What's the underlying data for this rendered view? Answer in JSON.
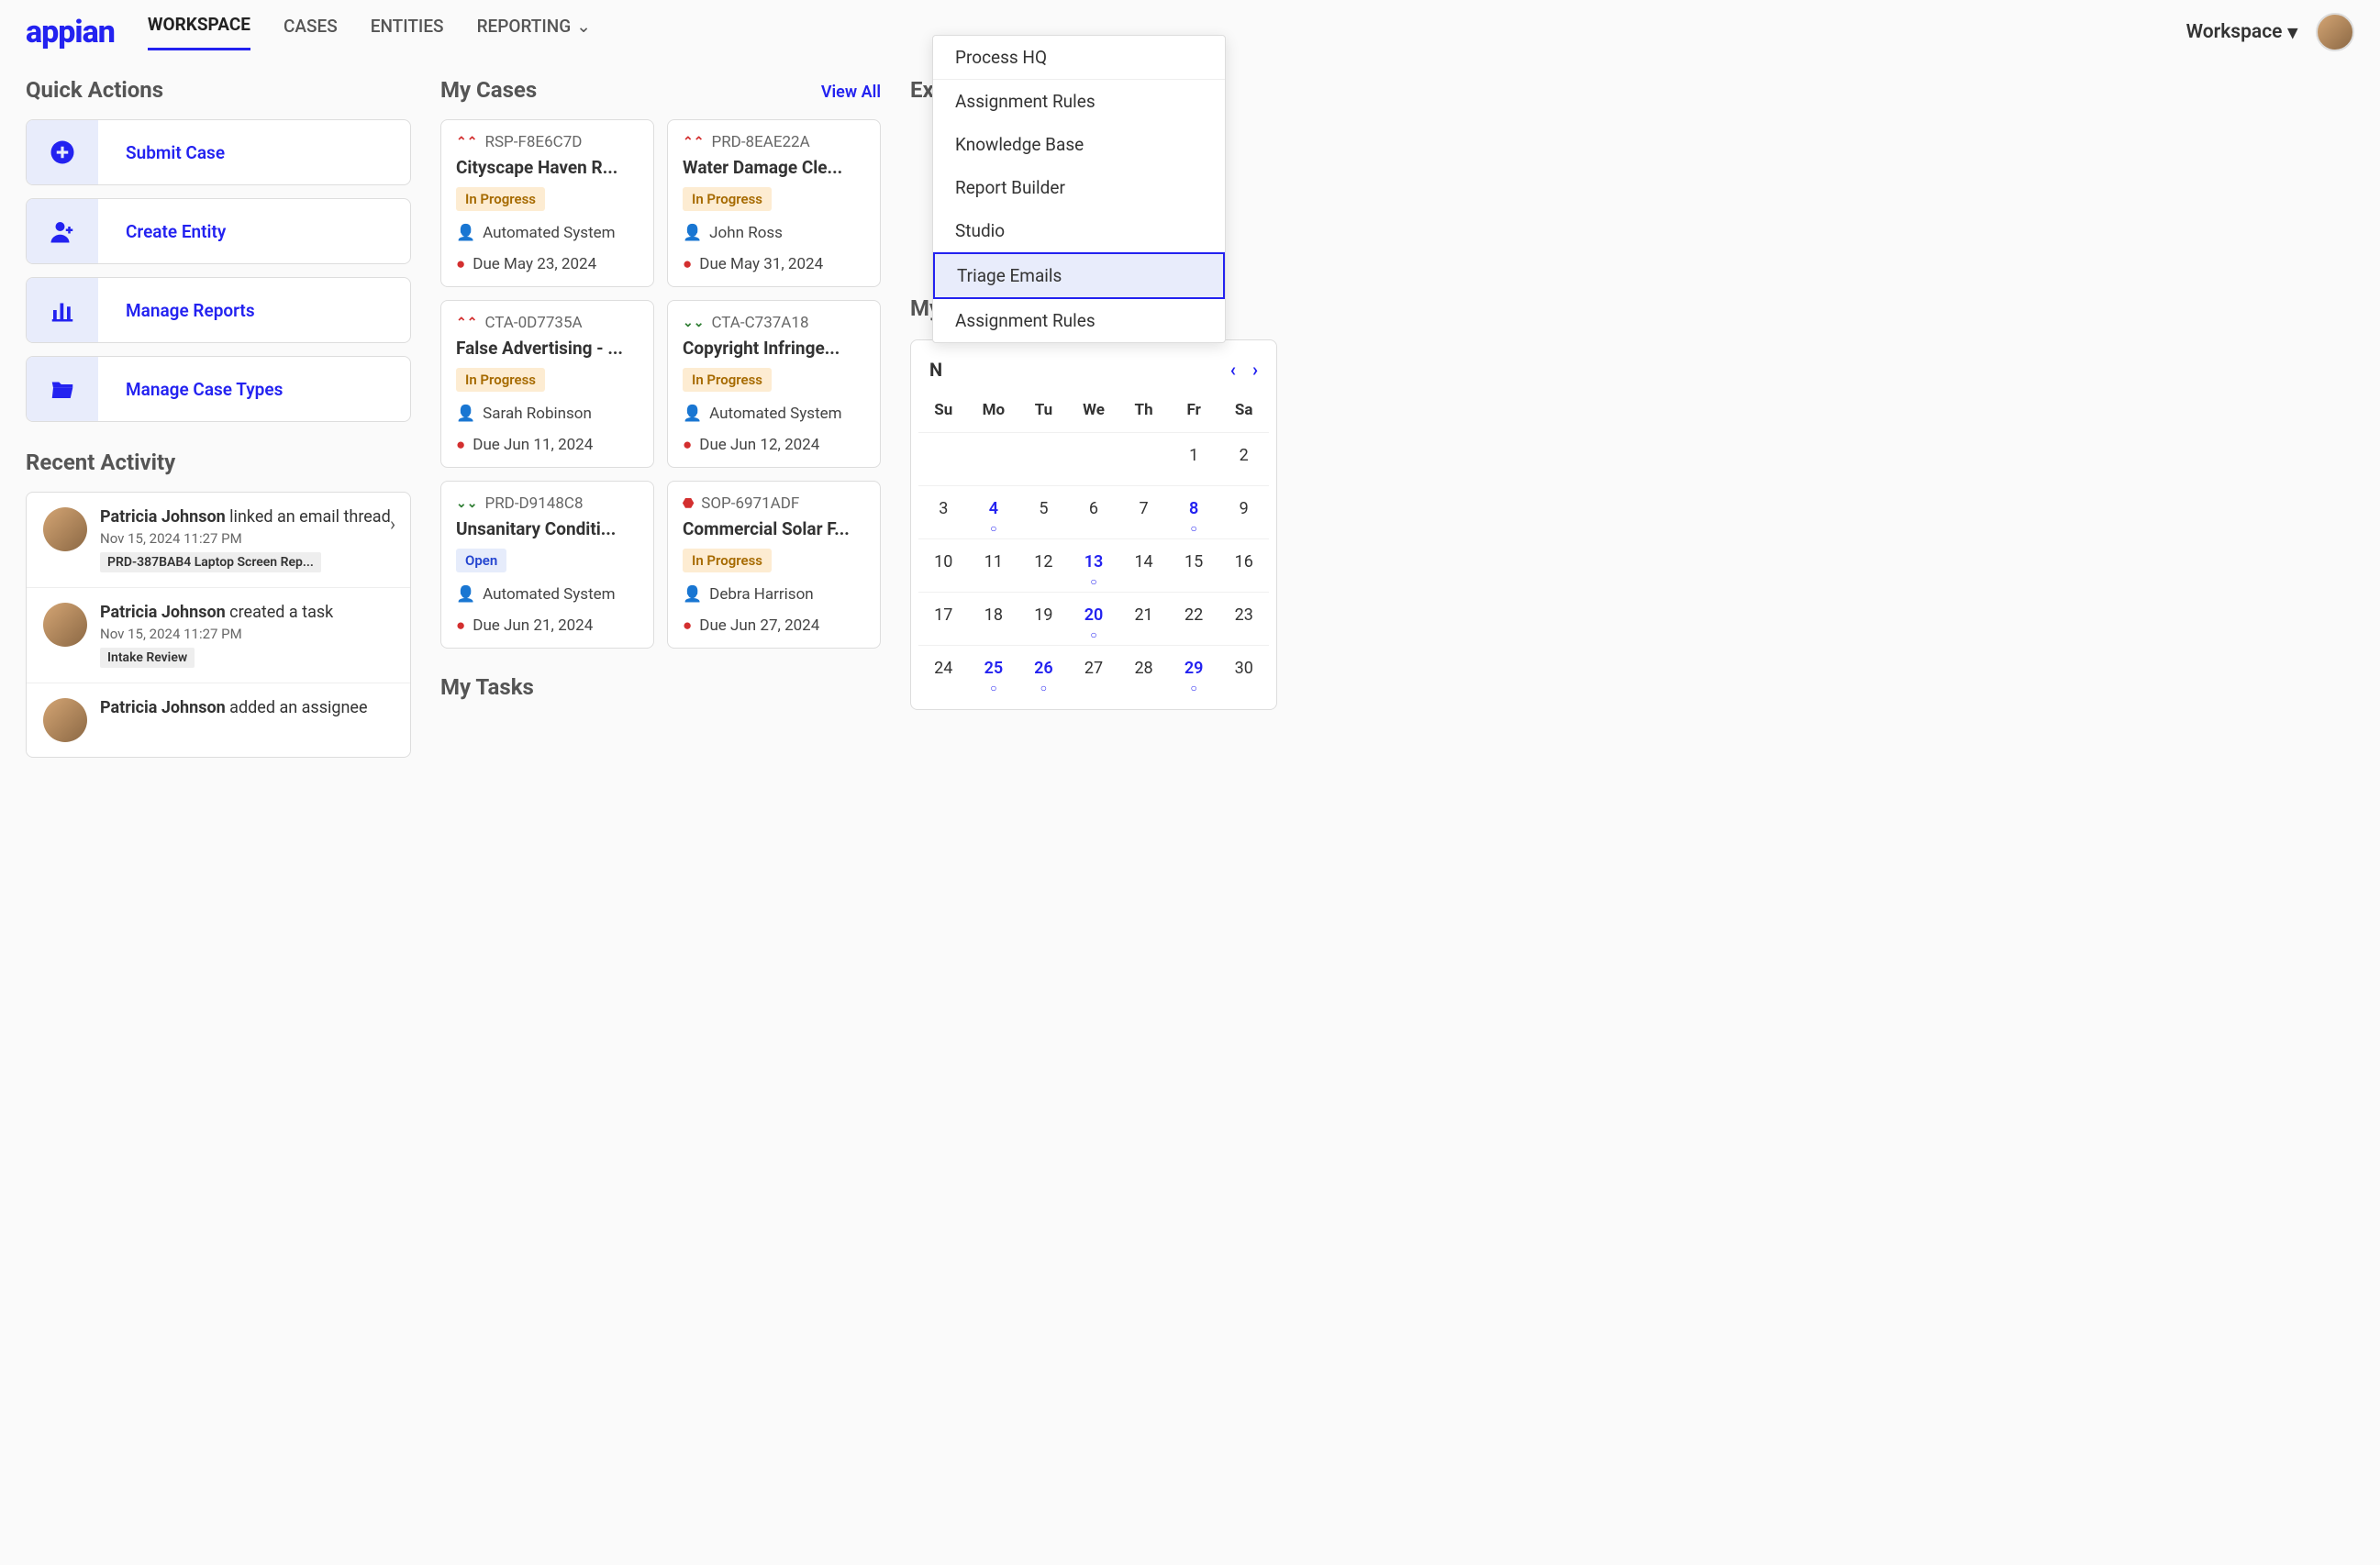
{
  "logo": "appian",
  "nav": {
    "workspace": "WORKSPACE",
    "cases": "CASES",
    "entities": "ENTITIES",
    "reporting": "REPORTING"
  },
  "header_right": {
    "workspace_label": "Workspace"
  },
  "quick_actions": {
    "title": "Quick Actions",
    "items": [
      {
        "label": "Submit Case"
      },
      {
        "label": "Create Entity"
      },
      {
        "label": "Manage Reports"
      },
      {
        "label": "Manage Case Types"
      }
    ]
  },
  "recent_activity": {
    "title": "Recent Activity",
    "items": [
      {
        "actor": "Patricia Johnson",
        "action": " linked an email thread",
        "time": "Nov 15, 2024 11:27 PM",
        "tag": "PRD-387BAB4 Laptop Screen Rep..."
      },
      {
        "actor": "Patricia Johnson",
        "action": " created a task",
        "time": "Nov 15, 2024 11:27 PM",
        "tag": "Intake Review"
      },
      {
        "actor": "Patricia Johnson",
        "action": " added an assignee",
        "time": "",
        "tag": ""
      }
    ]
  },
  "my_cases": {
    "title": "My Cases",
    "view_all": "View All",
    "cards": [
      {
        "id": "RSP-F8E6C7D",
        "title": "Cityscape Haven R...",
        "status": "In Progress",
        "status_kind": "inprogress",
        "assignee": "Automated System",
        "due": "Due May 23, 2024",
        "priority": "high"
      },
      {
        "id": "PRD-8EAE22A",
        "title": "Water Damage Cle...",
        "status": "In Progress",
        "status_kind": "inprogress",
        "assignee": "John Ross",
        "due": "Due May 31, 2024",
        "priority": "high"
      },
      {
        "id": "CTA-0D7735A",
        "title": "False Advertising - ...",
        "status": "In Progress",
        "status_kind": "inprogress",
        "assignee": "Sarah Robinson",
        "due": "Due Jun 11, 2024",
        "priority": "high"
      },
      {
        "id": "CTA-C737A18",
        "title": "Copyright Infringe...",
        "status": "In Progress",
        "status_kind": "inprogress",
        "assignee": "Automated System",
        "due": "Due Jun 12, 2024",
        "priority": "low"
      },
      {
        "id": "PRD-D9148C8",
        "title": "Unsanitary Conditi...",
        "status": "Open",
        "status_kind": "open",
        "assignee": "Automated System",
        "due": "Due Jun 21, 2024",
        "priority": "low"
      },
      {
        "id": "SOP-6971ADF",
        "title": "Commercial Solar F...",
        "status": "In Progress",
        "status_kind": "inprogress",
        "assignee": "Debra Harrison",
        "due": "Due Jun 27, 2024",
        "priority": "fire"
      }
    ]
  },
  "my_tasks": {
    "title": "My Tasks"
  },
  "explore": {
    "title_partial": "Ex"
  },
  "my_calendar": {
    "title_partial": "My"
  },
  "dropdown": {
    "items": [
      {
        "label": "Process HQ",
        "sep": true
      },
      {
        "label": "Assignment Rules"
      },
      {
        "label": "Knowledge Base"
      },
      {
        "label": "Report Builder"
      },
      {
        "label": "Studio"
      },
      {
        "label": "Triage Emails",
        "selected": true
      },
      {
        "label": "Assignment Rules"
      }
    ]
  },
  "calendar": {
    "month_partial": "N",
    "dow": [
      "Su",
      "Mo",
      "Tu",
      "We",
      "Th",
      "Fr",
      "Sa"
    ],
    "weeks": [
      [
        {
          "d": ""
        },
        {
          "d": ""
        },
        {
          "d": ""
        },
        {
          "d": ""
        },
        {
          "d": ""
        },
        {
          "d": "1"
        },
        {
          "d": "2"
        }
      ],
      [
        {
          "d": "3"
        },
        {
          "d": "4",
          "m": true
        },
        {
          "d": "5"
        },
        {
          "d": "6"
        },
        {
          "d": "7"
        },
        {
          "d": "8",
          "m": true
        },
        {
          "d": "9"
        }
      ],
      [
        {
          "d": "10"
        },
        {
          "d": "11"
        },
        {
          "d": "12"
        },
        {
          "d": "13",
          "m": true
        },
        {
          "d": "14"
        },
        {
          "d": "15"
        },
        {
          "d": "16"
        }
      ],
      [
        {
          "d": "17"
        },
        {
          "d": "18"
        },
        {
          "d": "19"
        },
        {
          "d": "20",
          "m": true
        },
        {
          "d": "21"
        },
        {
          "d": "22"
        },
        {
          "d": "23"
        }
      ],
      [
        {
          "d": "24"
        },
        {
          "d": "25",
          "m": true
        },
        {
          "d": "26",
          "m": true
        },
        {
          "d": "27"
        },
        {
          "d": "28"
        },
        {
          "d": "29",
          "m": true
        },
        {
          "d": "30"
        }
      ]
    ]
  }
}
